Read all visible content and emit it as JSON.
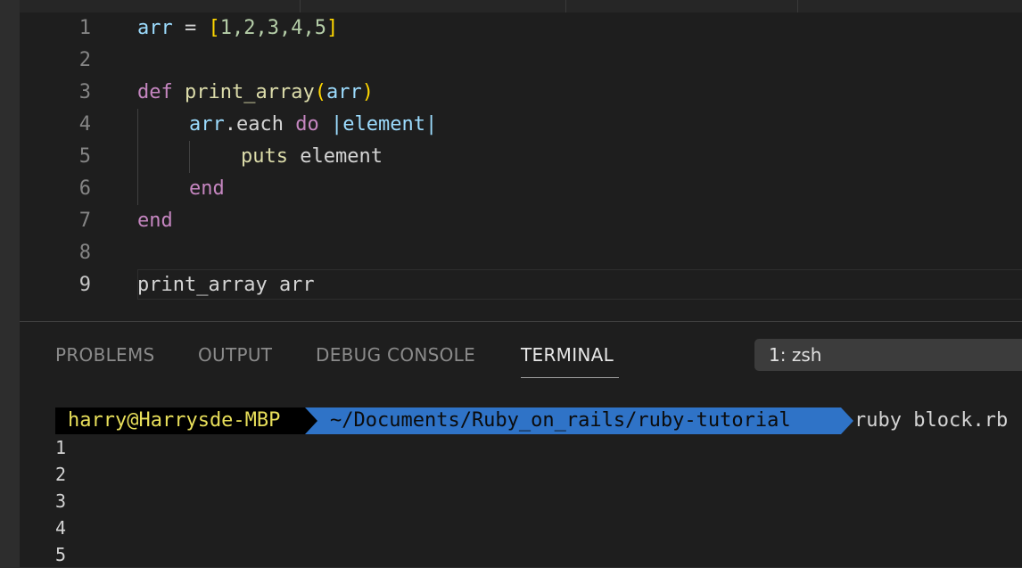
{
  "editor": {
    "line_numbers": [
      "1",
      "2",
      "3",
      "4",
      "5",
      "6",
      "7",
      "8",
      "9"
    ],
    "active_line": "9",
    "code": {
      "l1": {
        "var": "arr",
        "eq": " = ",
        "open": "[",
        "nums": "1,2,3,4,5",
        "close": "]"
      },
      "l3": {
        "def": "def",
        "fn": "print_array",
        "open": "(",
        "arg": "arr",
        "close": ")"
      },
      "l4": {
        "recv": "arr",
        "method": ".each ",
        "do": "do",
        "param": " |element|"
      },
      "l5": {
        "puts": "puts",
        "arg": " element"
      },
      "l6": {
        "end": "end"
      },
      "l7": {
        "end": "end"
      },
      "l9": {
        "text": "print_array arr"
      }
    }
  },
  "panel": {
    "tabs": [
      "PROBLEMS",
      "OUTPUT",
      "DEBUG CONSOLE",
      "TERMINAL"
    ],
    "active_tab": "TERMINAL",
    "terminal_select": "1: zsh"
  },
  "terminal": {
    "user_host": "harry@Harrysde-MBP",
    "path": "~/Documents/Ruby_on_rails/ruby-tutorial",
    "command": "ruby block.rb",
    "output": [
      "1",
      "2",
      "3",
      "4",
      "5"
    ]
  },
  "colors": {
    "keyword": "#c586c0",
    "function": "#dcdcaa",
    "variable": "#9cdcfe",
    "prompt_user_fg": "#e8df5a",
    "prompt_path_bg": "#2f73c7"
  }
}
